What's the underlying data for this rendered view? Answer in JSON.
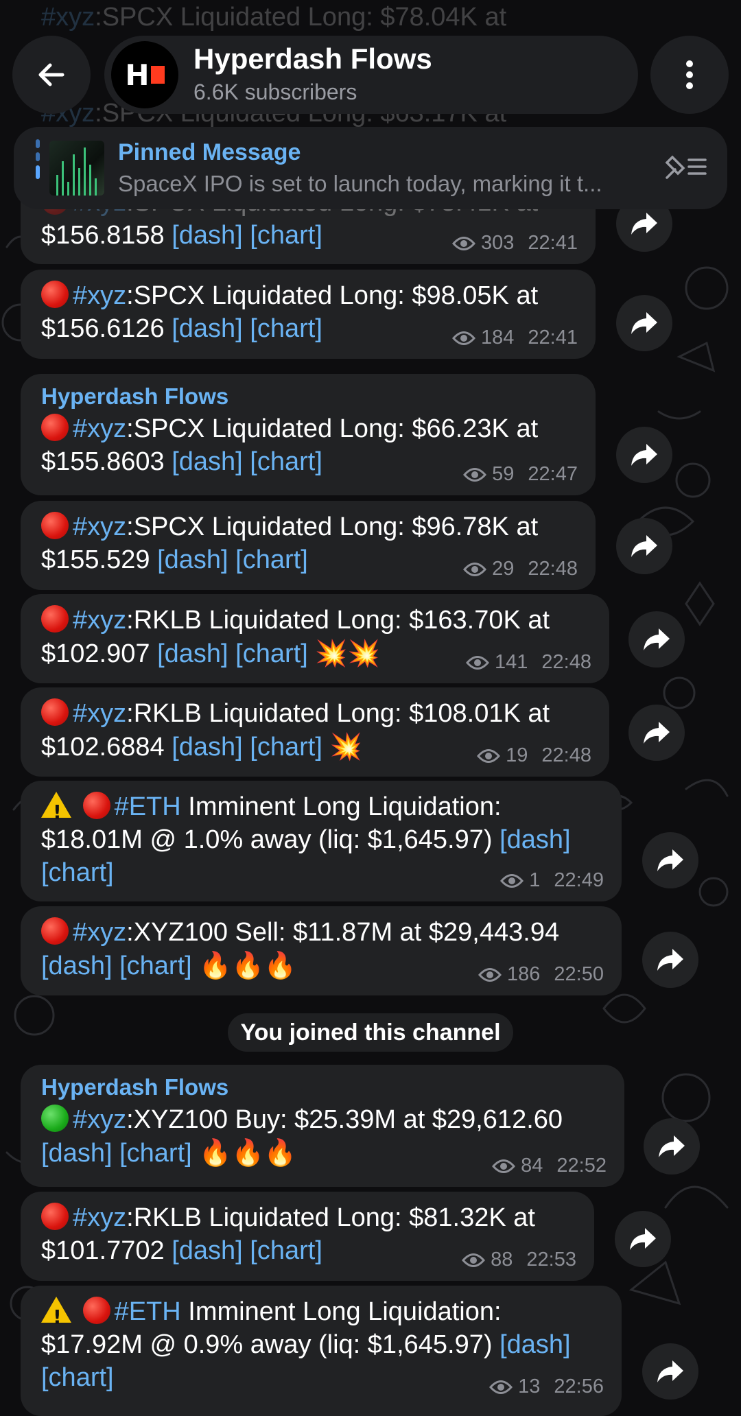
{
  "header": {
    "back_label": "Back",
    "channel_title": "Hyperdash Flows",
    "subscribers": "6.6K subscribers",
    "avatar_text": "H"
  },
  "ghost_lines": [
    {
      "tag": "#xyz",
      "text": ":SPCX Liquidated Long: $78.04K at"
    },
    {
      "tag": "#xyz",
      "text": ":SPCX Liquidated Long: $63.17K at"
    }
  ],
  "pinned": {
    "title": "Pinned Message",
    "text": "SpaceX IPO is set to launch today, marking it t..."
  },
  "service_message": "You joined this channel",
  "messages": [
    {
      "tag": "#xyz",
      "body": ":SPCX Liquidated Long: $78.41K at",
      "line2": "$156.8158",
      "links": [
        "[dash]",
        "[chart]"
      ],
      "views": "303",
      "time": "22:41"
    },
    {
      "tag": "#xyz",
      "body": ":SPCX Liquidated Long: $98.05K at",
      "line2": "$156.6126",
      "links": [
        "[dash]",
        "[chart]"
      ],
      "views": "184",
      "time": "22:41"
    },
    {
      "sender": "Hyperdash Flows",
      "tag": "#xyz",
      "body": ":SPCX Liquidated Long: $66.23K at",
      "line2": "$155.8603",
      "links": [
        "[dash]",
        "[chart]"
      ],
      "views": "59",
      "time": "22:47"
    },
    {
      "tag": "#xyz",
      "body": ":SPCX Liquidated Long: $96.78K at",
      "line2": "$155.529",
      "links": [
        "[dash]",
        "[chart]"
      ],
      "views": "29",
      "time": "22:48"
    },
    {
      "tag": "#xyz",
      "body": ":RKLB Liquidated Long: $163.70K at",
      "line2": "$102.907",
      "links": [
        "[dash]",
        "[chart]"
      ],
      "emoji": "💥💥",
      "views": "141",
      "time": "22:48"
    },
    {
      "tag": "#xyz",
      "body": ":RKLB Liquidated Long: $108.01K at",
      "line2": "$102.6884",
      "links": [
        "[dash]",
        "[chart]"
      ],
      "emoji": "💥",
      "views": "19",
      "time": "22:48"
    },
    {
      "tag": "#ETH",
      "body": " Imminent Long Liquidation:",
      "line2": "$18.01M @ 1.0% away (liq: $1,645.97)",
      "links": [
        "[dash]",
        "[chart]"
      ],
      "views": "1",
      "time": "22:49"
    },
    {
      "tag": "#xyz",
      "body": ":XYZ100 Sell: $11.87M at $29,443.94",
      "links": [
        "[dash]",
        "[chart]"
      ],
      "emoji": "🔥🔥🔥",
      "views": "186",
      "time": "22:50"
    },
    {
      "sender": "Hyperdash Flows",
      "tag": "#xyz",
      "body": ":XYZ100 Buy: $25.39M at $29,612.60",
      "links": [
        "[dash]",
        "[chart]"
      ],
      "emoji": "🔥🔥🔥",
      "views": "84",
      "time": "22:52"
    },
    {
      "tag": "#xyz",
      "body": ":RKLB Liquidated Long: $81.32K at",
      "line2": "$101.7702",
      "links": [
        "[dash]",
        "[chart]"
      ],
      "views": "88",
      "time": "22:53"
    },
    {
      "tag": "#ETH",
      "body": " Imminent Long Liquidation:",
      "line2": "$17.92M @ 0.9% away (liq: $1,645.97)",
      "links": [
        "[dash]",
        "[chart]"
      ],
      "views": "13",
      "time": "22:56"
    }
  ],
  "colors": {
    "background": "#0d0d0f",
    "bubble": "#212224",
    "accent": "#6ab3f3",
    "meta": "#8d8f96"
  }
}
